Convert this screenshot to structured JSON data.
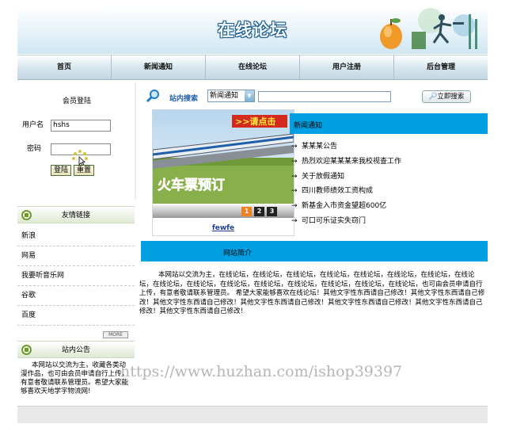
{
  "header": {
    "title": "在线论坛"
  },
  "nav": {
    "items": [
      {
        "label": "首页"
      },
      {
        "label": "新闻通知"
      },
      {
        "label": "在线论坛"
      },
      {
        "label": "用户注册"
      },
      {
        "label": "后台管理"
      }
    ]
  },
  "login": {
    "title": "会员登陆",
    "username_label": "用户名",
    "username_value": "hshs",
    "password_label": "密码",
    "password_value": "",
    "login_button": "登陆",
    "reset_button": "重置"
  },
  "friend_links": {
    "title": "友情链接",
    "items": [
      "新浪",
      "网易",
      "我要听音乐网",
      "谷歌",
      "百度"
    ],
    "more_label": "MORE"
  },
  "announcement": {
    "title": "站内公告",
    "text": "本网站以交流为主，收藏各类动漫作品，也可由会员申请自行上传，有意者敬请联系管理员。希望大家能够喜欢天地学字物流网!"
  },
  "search": {
    "label": "站内搜索",
    "selected_option": "新闻通知",
    "input_value": "",
    "button_label": "立即搜索"
  },
  "banner": {
    "badge_text": ">>请点击",
    "promo_text": "火车票预订",
    "pages": [
      "1",
      "2",
      "3"
    ],
    "caption": "fewfe"
  },
  "news": {
    "title": "新闻通知",
    "bullet": "→",
    "items": [
      "某某某公告",
      "热烈欢迎某某某来我校视查工作",
      "关于放假通知",
      "四川教师绩效工资构成",
      "新基金入市资金望超600亿",
      "可口可乐证实失窃门"
    ]
  },
  "intro": {
    "title": "网站简介",
    "text": "本网站以交流为主，在线论坛，在线论坛，在线论坛，在线论坛，在线论坛，在线论坛，在线论坛，在线论坛，在线论坛，在线论坛，在线论坛，在线论坛，在线论坛，在线论坛，在线论坛，在线论坛，也可由会员申请自行上传，有意者敬请联系管理员。 希望大家能够喜欢在线论坛！其他文字性东西请自己修改！其他文字性东西请自己修改！其他文字性东西请自己修改！其他文字性东西请自己修改！其他文字性东西请自己修改！其他文字性东西请自己修改！其他文字性东西请自己修改！"
  },
  "watermark": "https://www.huzhan.com/ishop39397",
  "colors": {
    "accent_blue": "#00a0e3",
    "link_blue": "#1f5ea8"
  }
}
